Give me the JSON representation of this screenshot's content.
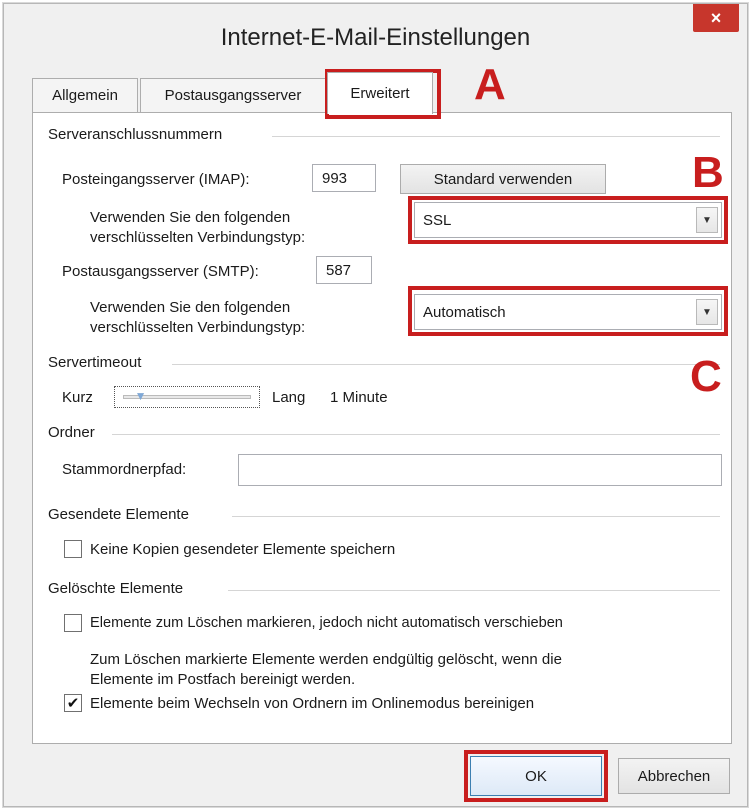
{
  "window": {
    "title": "Internet-E-Mail-Einstellungen",
    "close_icon": "×"
  },
  "tabs": [
    {
      "label": "Allgemein"
    },
    {
      "label": "Postausgangsserver"
    },
    {
      "label": "Erweitert",
      "active": true
    }
  ],
  "annotations": {
    "a": "A",
    "b": "B",
    "c": "C",
    "color": "#c81e1e"
  },
  "server_ports": {
    "group_title": "Serveranschlussnummern",
    "incoming_label": "Posteingangsserver (IMAP):",
    "incoming_value": "993",
    "default_button": "Standard verwenden",
    "enc_label_line1": "Verwenden Sie den folgenden",
    "enc_label_line2": "verschlüsselten Verbindungstyp:",
    "incoming_enc_value": "SSL",
    "outgoing_label": "Postausgangsserver (SMTP):",
    "outgoing_value": "587",
    "outgoing_enc_value": "Automatisch"
  },
  "timeout": {
    "group_title": "Servertimeout",
    "short_label": "Kurz",
    "long_label": "Lang",
    "value_label": "1 Minute",
    "slider_level": 0.1
  },
  "folders": {
    "group_title": "Ordner",
    "root_label": "Stammordnerpfad:",
    "root_value": ""
  },
  "sent": {
    "group_title": "Gesendete Elemente",
    "no_copies_label": "Keine Kopien gesendeter Elemente speichern",
    "no_copies_checked": false
  },
  "deleted": {
    "group_title": "Gelöschte Elemente",
    "mark_label": "Elemente zum Löschen markieren, jedoch nicht automatisch verschieben",
    "mark_checked": false,
    "note_line1": "Zum Löschen markierte Elemente werden endgültig gelöscht, wenn die",
    "note_line2": "Elemente im Postfach bereinigt werden.",
    "purge_label": "Elemente beim Wechseln von Ordnern im Onlinemodus bereinigen",
    "purge_checked": true
  },
  "footer": {
    "ok": "OK",
    "cancel": "Abbrechen"
  }
}
